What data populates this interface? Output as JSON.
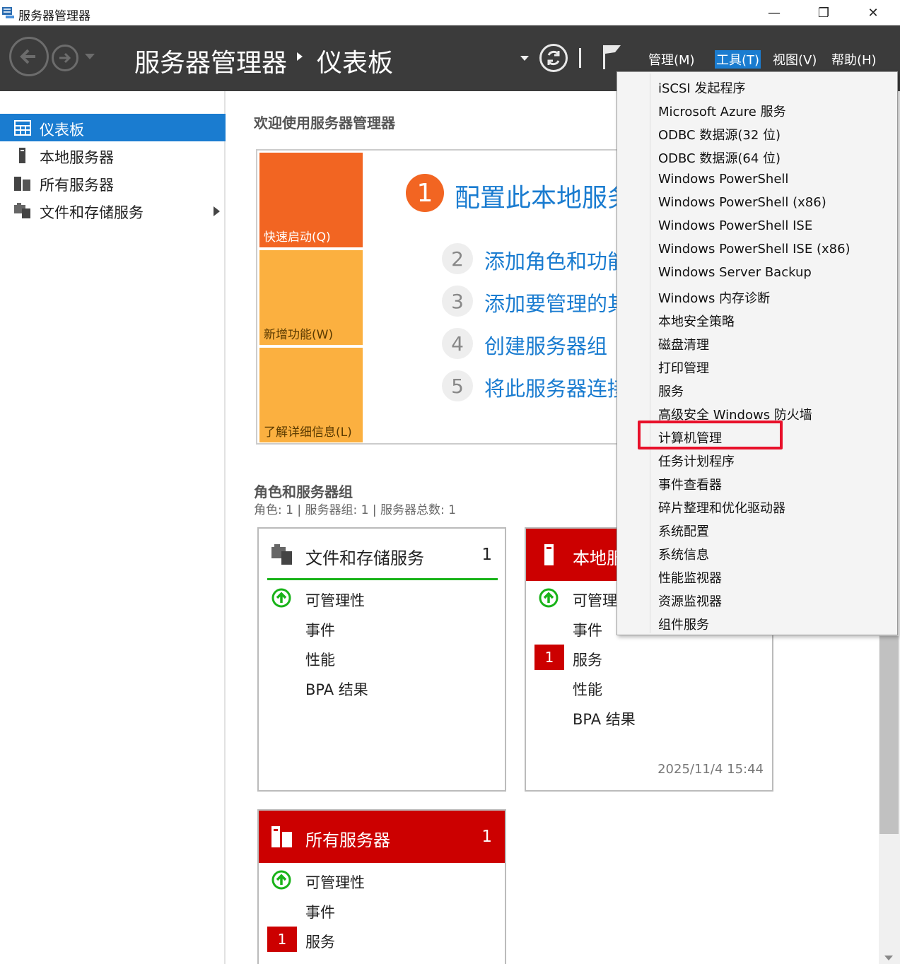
{
  "window": {
    "title": "服务器管理器",
    "minimize": "—",
    "maximize": "❐",
    "close": "✕"
  },
  "header": {
    "breadcrumb_root": "服务器管理器",
    "breadcrumb_current": "仪表板",
    "menus": [
      "管理(M)",
      "工具(T)",
      "视图(V)",
      "帮助(H)"
    ],
    "active_menu": "工具(T)"
  },
  "sidebar": {
    "items": [
      {
        "label": "仪表板",
        "selected": true
      },
      {
        "label": "本地服务器"
      },
      {
        "label": "所有服务器"
      },
      {
        "label": "文件和存储服务",
        "has_submenu": true
      }
    ]
  },
  "main": {
    "welcome_title": "欢迎使用服务器管理器",
    "quick_start": {
      "tiles": [
        "快速启动(Q)",
        "新增功能(W)",
        "了解详细信息(L)"
      ],
      "steps": [
        {
          "num": "1",
          "label": "配置此本地服务"
        },
        {
          "num": "2",
          "label": "添加角色和功能"
        },
        {
          "num": "3",
          "label": "添加要管理的其"
        },
        {
          "num": "4",
          "label": "创建服务器组"
        },
        {
          "num": "5",
          "label": "将此服务器连接"
        }
      ]
    },
    "roles": {
      "title": "角色和服务器组",
      "subtitle": "角色: 1 | 服务器组: 1 | 服务器总数: 1"
    },
    "cards": [
      {
        "title": "文件和存储服务",
        "count": "1",
        "rows": [
          "可管理性",
          "事件",
          "性能",
          "BPA 结果"
        ]
      },
      {
        "title": "本地服",
        "count": "1",
        "rows": [
          "可管理",
          "事件",
          "服务",
          "性能",
          "BPA 结果"
        ],
        "badge": "1",
        "timestamp": "2025/11/4 15:44"
      },
      {
        "title": "所有服务器",
        "count": "1",
        "rows": [
          "可管理性",
          "事件",
          "服务",
          "性能"
        ],
        "badge": "1"
      }
    ]
  },
  "tools_menu": {
    "items": [
      "iSCSI 发起程序",
      "Microsoft Azure 服务",
      "ODBC 数据源(32 位)",
      "ODBC 数据源(64 位)",
      "Windows PowerShell",
      "Windows PowerShell (x86)",
      "Windows PowerShell ISE",
      "Windows PowerShell ISE (x86)",
      "Windows Server Backup",
      "Windows 内存诊断",
      "本地安全策略",
      "磁盘清理",
      "打印管理",
      "服务",
      "高级安全 Windows 防火墙",
      "计算机管理",
      "任务计划程序",
      "事件查看器",
      "碎片整理和优化驱动器",
      "系统配置",
      "系统信息",
      "性能监视器",
      "资源监视器",
      "组件服务"
    ],
    "highlighted_item": "计算机管理"
  },
  "colors": {
    "accent": "#1a7cd0",
    "header_bg": "#3b3b3b",
    "quick_start_orange": "#f26522",
    "tile_amber": "#fbb040",
    "alert_red": "#cc0000",
    "ok_green": "#19b319",
    "highlight_red": "#e8102a"
  }
}
